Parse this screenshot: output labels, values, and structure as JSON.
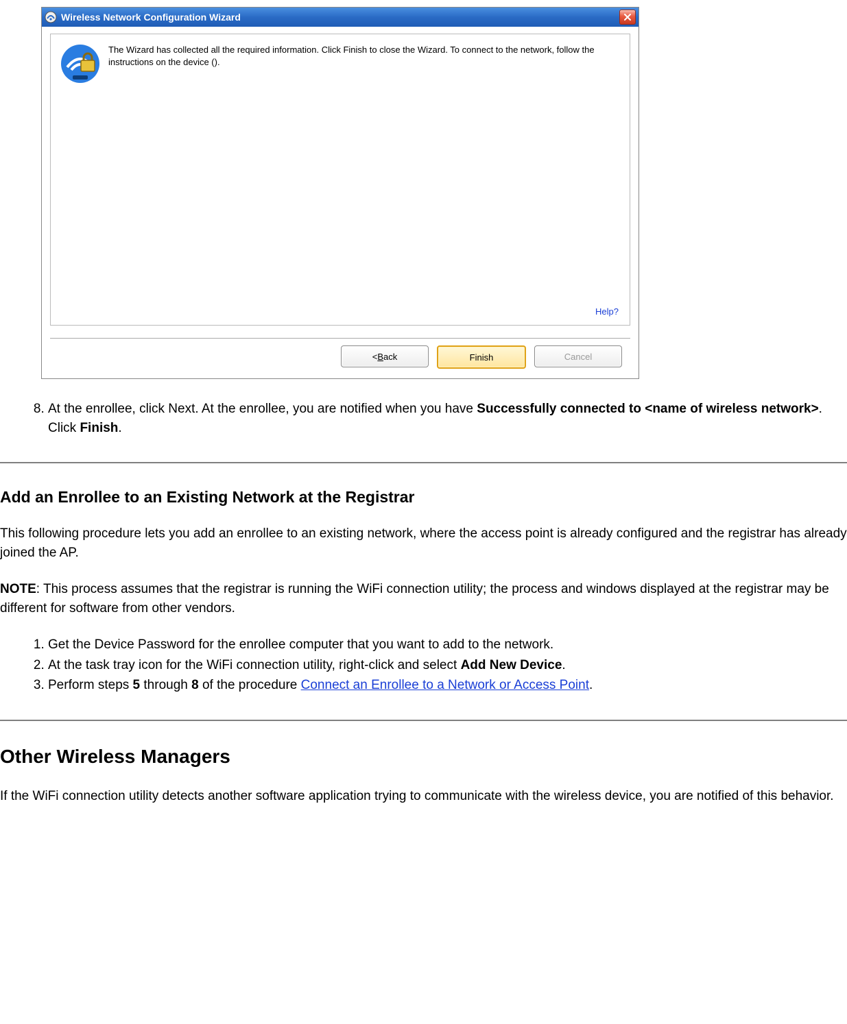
{
  "wizard": {
    "title": "Wireless Network Configuration Wizard",
    "message": "The Wizard has collected all the required information. Click Finish to close the Wizard. To connect to the network, follow the instructions on the device ().",
    "help": "Help?",
    "buttons": {
      "back_prefix": "< ",
      "back_key": "B",
      "back_suffix": "ack",
      "finish": "Finish",
      "cancel": "Cancel"
    }
  },
  "step8": {
    "number": "8.",
    "pre": "At the enrollee, click Next. At the enrollee, you are notified when you have ",
    "bold1": "Successfully connected to <name of wireless network>",
    "mid": ". Click ",
    "bold2": "Finish",
    "post": "."
  },
  "sectionA": {
    "heading": "Add an Enrollee to an Existing Network at the Registrar",
    "para1": "This following procedure lets you add an enrollee to an existing network, where the access point is already configured and the registrar has already joined the AP.",
    "note_label": "NOTE",
    "note_body": ": This process assumes that the registrar is running the WiFi connection utility; the process and windows displayed at the registrar may be different for software from other vendors.",
    "steps": {
      "s1": "Get the Device Password for the enrollee computer that you want to add to the network.",
      "s2_pre": "At the task tray icon for the WiFi connection utility, right-click and select ",
      "s2_bold": "Add New Device",
      "s2_post": ".",
      "s3_pre": "Perform steps ",
      "s3_b1": "5",
      "s3_mid1": " through ",
      "s3_b2": "8",
      "s3_mid2": " of the procedure ",
      "s3_link": "Connect an Enrollee to a Network or Access Point",
      "s3_post": "."
    }
  },
  "sectionB": {
    "heading": "Other Wireless Managers",
    "para": "If the WiFi connection utility detects another software application trying to communicate with the wireless device, you are notified of this behavior."
  }
}
